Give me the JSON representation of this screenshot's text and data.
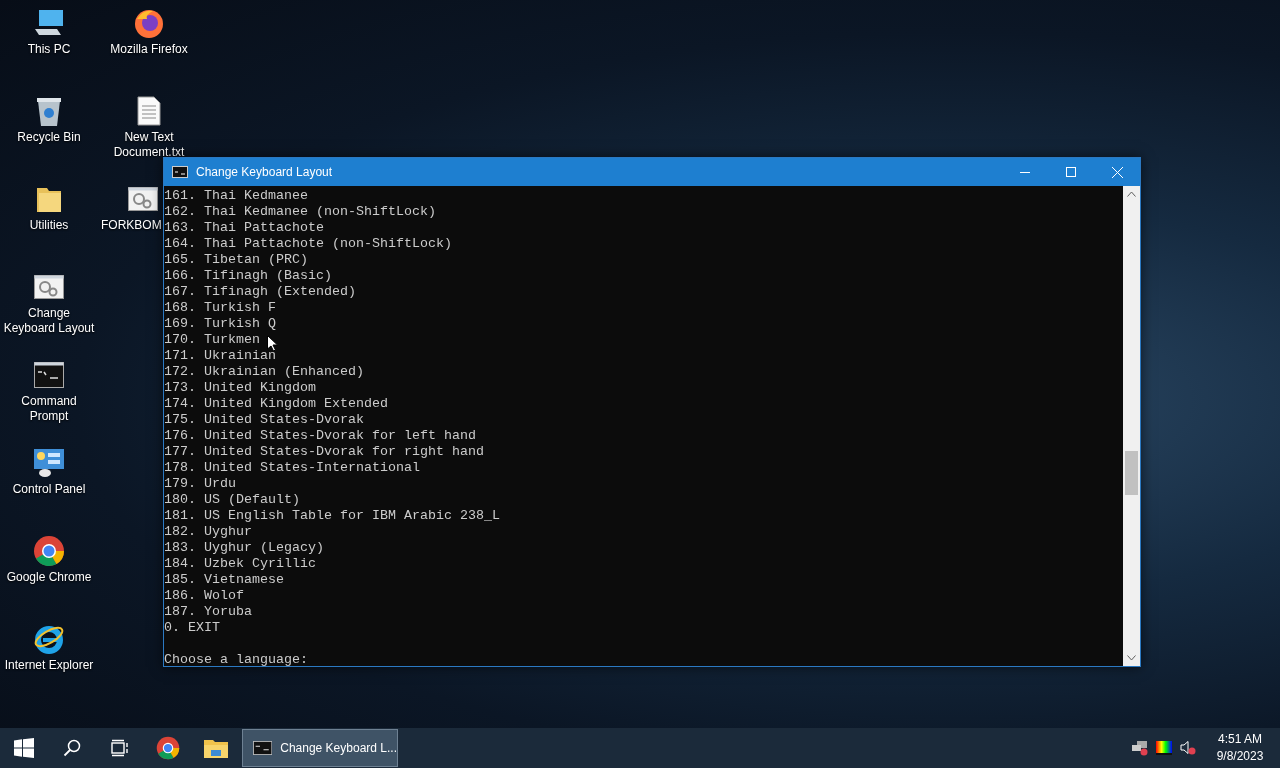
{
  "desktop": {
    "columns": [
      [
        {
          "label": "This PC",
          "kind": "computer"
        },
        {
          "label": "Recycle Bin",
          "kind": "recycle"
        },
        {
          "label": "Utilities",
          "kind": "folder"
        },
        {
          "label": "Change Keyboard Layout",
          "kind": "app"
        },
        {
          "label": "Command Prompt",
          "kind": "console"
        },
        {
          "label": "Control Panel",
          "kind": "controlpanel"
        },
        {
          "label": "Google Chrome",
          "kind": "chrome"
        },
        {
          "label": "Internet Explorer",
          "kind": "ie"
        }
      ],
      [
        {
          "label": "Mozilla Firefox",
          "kind": "firefox"
        },
        {
          "label": "New Text Document.txt",
          "kind": "textfile"
        },
        {
          "label": "FORKBOM",
          "kind": "app",
          "clipped": true
        }
      ]
    ]
  },
  "window": {
    "title": "Change Keyboard Layout",
    "lines": [
      "161. Thai Kedmanee",
      "162. Thai Kedmanee (non-ShiftLock)",
      "163. Thai Pattachote",
      "164. Thai Pattachote (non-ShiftLock)",
      "165. Tibetan (PRC)",
      "166. Tifinagh (Basic)",
      "167. Tifinagh (Extended)",
      "168. Turkish F",
      "169. Turkish Q",
      "170. Turkmen",
      "171. Ukrainian",
      "172. Ukrainian (Enhanced)",
      "173. United Kingdom",
      "174. United Kingdom Extended",
      "175. United States-Dvorak",
      "176. United States-Dvorak for left hand",
      "177. United States-Dvorak for right hand",
      "178. United States-International",
      "179. Urdu",
      "180. US (Default)",
      "181. US English Table for IBM Arabic 238_L",
      "182. Uyghur",
      "183. Uyghur (Legacy)",
      "184. Uzbek Cyrillic",
      "185. Vietnamese",
      "186. Wolof",
      "187. Yoruba",
      "0. EXIT"
    ],
    "prompt": "Choose a language:"
  },
  "taskbar": {
    "pinned": [
      {
        "kind": "start"
      },
      {
        "kind": "search"
      },
      {
        "kind": "taskview"
      },
      {
        "kind": "chrome"
      },
      {
        "kind": "explorer"
      }
    ],
    "tasks": [
      {
        "label": "Change Keyboard L...",
        "selected": true
      }
    ],
    "tray": [
      {
        "kind": "network"
      },
      {
        "kind": "display"
      },
      {
        "kind": "volume"
      }
    ],
    "time": "4:51 AM",
    "date": "9/8/2023"
  }
}
